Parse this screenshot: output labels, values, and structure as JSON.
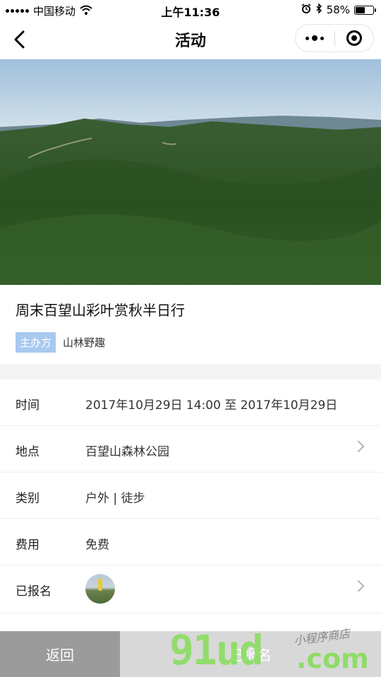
{
  "status_bar": {
    "carrier": "中国移动",
    "time": "上午11:36",
    "battery_percent": "58%",
    "battery_level": 0.58,
    "icons": [
      "signal-icon",
      "wifi-icon",
      "alarm-icon",
      "bluetooth-icon",
      "battery-icon"
    ]
  },
  "nav": {
    "title": "活动",
    "icons": [
      "back-arrow-icon",
      "more-dots-icon",
      "close-target-icon"
    ]
  },
  "event": {
    "title": "周末百望山彩叶赏秋半日行",
    "organizer_tag": "主办方",
    "organizer_name": "山林野趣"
  },
  "info": [
    {
      "label": "时间",
      "value": "2017年10月29日 14:00 至 2017年10月29日",
      "has_arrow": false
    },
    {
      "label": "地点",
      "value": "百望山森林公园",
      "has_arrow": true
    },
    {
      "label": "类别",
      "value": "户外 | 徒步",
      "has_arrow": false
    },
    {
      "label": "费用",
      "value": "免费",
      "has_arrow": false
    },
    {
      "label": "已报名",
      "value": "",
      "has_arrow": true
    }
  ],
  "bottom": {
    "back_label": "返回",
    "register_label": "已报名"
  },
  "watermark": {
    "main": "91ud",
    "sub": "小程序商店",
    "domain": ".com"
  },
  "colors": {
    "org_tag_bg": "#a8c9f0",
    "back_button_bg": "#9b9b9b",
    "register_button_bg": "#d8d8d8",
    "watermark_green": "#86dd5a"
  }
}
